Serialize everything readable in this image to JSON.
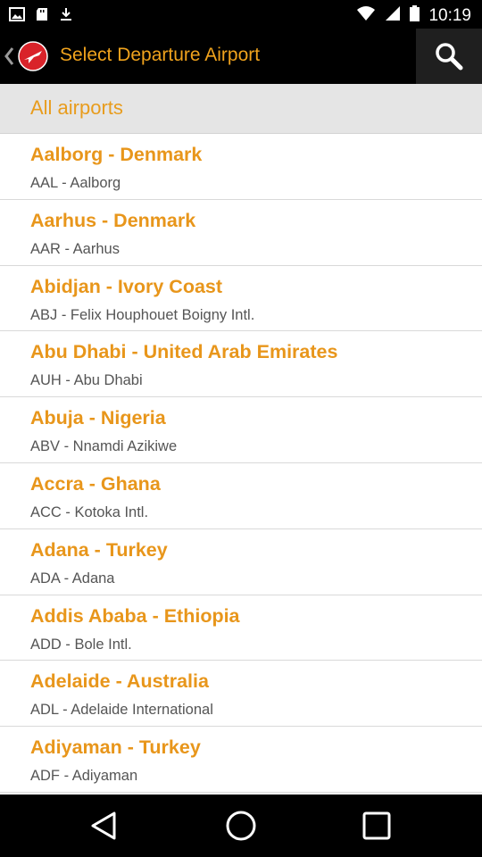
{
  "status_bar": {
    "time": "10:19"
  },
  "action_bar": {
    "title": "Select Departure Airport",
    "logo_icon": "red-plane-logo",
    "search_icon": "search-icon"
  },
  "section": {
    "title": "All airports"
  },
  "airports": [
    {
      "title": "Aalborg - Denmark",
      "sub": "AAL - Aalborg"
    },
    {
      "title": "Aarhus - Denmark",
      "sub": "AAR - Aarhus"
    },
    {
      "title": "Abidjan - Ivory Coast",
      "sub": "ABJ - Felix Houphouet Boigny Intl."
    },
    {
      "title": "Abu Dhabi - United Arab Emirates",
      "sub": "AUH - Abu Dhabi"
    },
    {
      "title": "Abuja - Nigeria",
      "sub": "ABV - Nnamdi Azikiwe"
    },
    {
      "title": "Accra - Ghana",
      "sub": "ACC - Kotoka Intl."
    },
    {
      "title": "Adana - Turkey",
      "sub": "ADA - Adana"
    },
    {
      "title": "Addis Ababa - Ethiopia",
      "sub": "ADD - Bole Intl."
    },
    {
      "title": "Adelaide - Australia",
      "sub": "ADL - Adelaide International"
    },
    {
      "title": "Adiyaman - Turkey",
      "sub": "ADF - Adiyaman"
    }
  ],
  "colors": {
    "accent": "#e8961b",
    "header_bg": "#e5e5e5",
    "bar_bg": "#000000"
  }
}
